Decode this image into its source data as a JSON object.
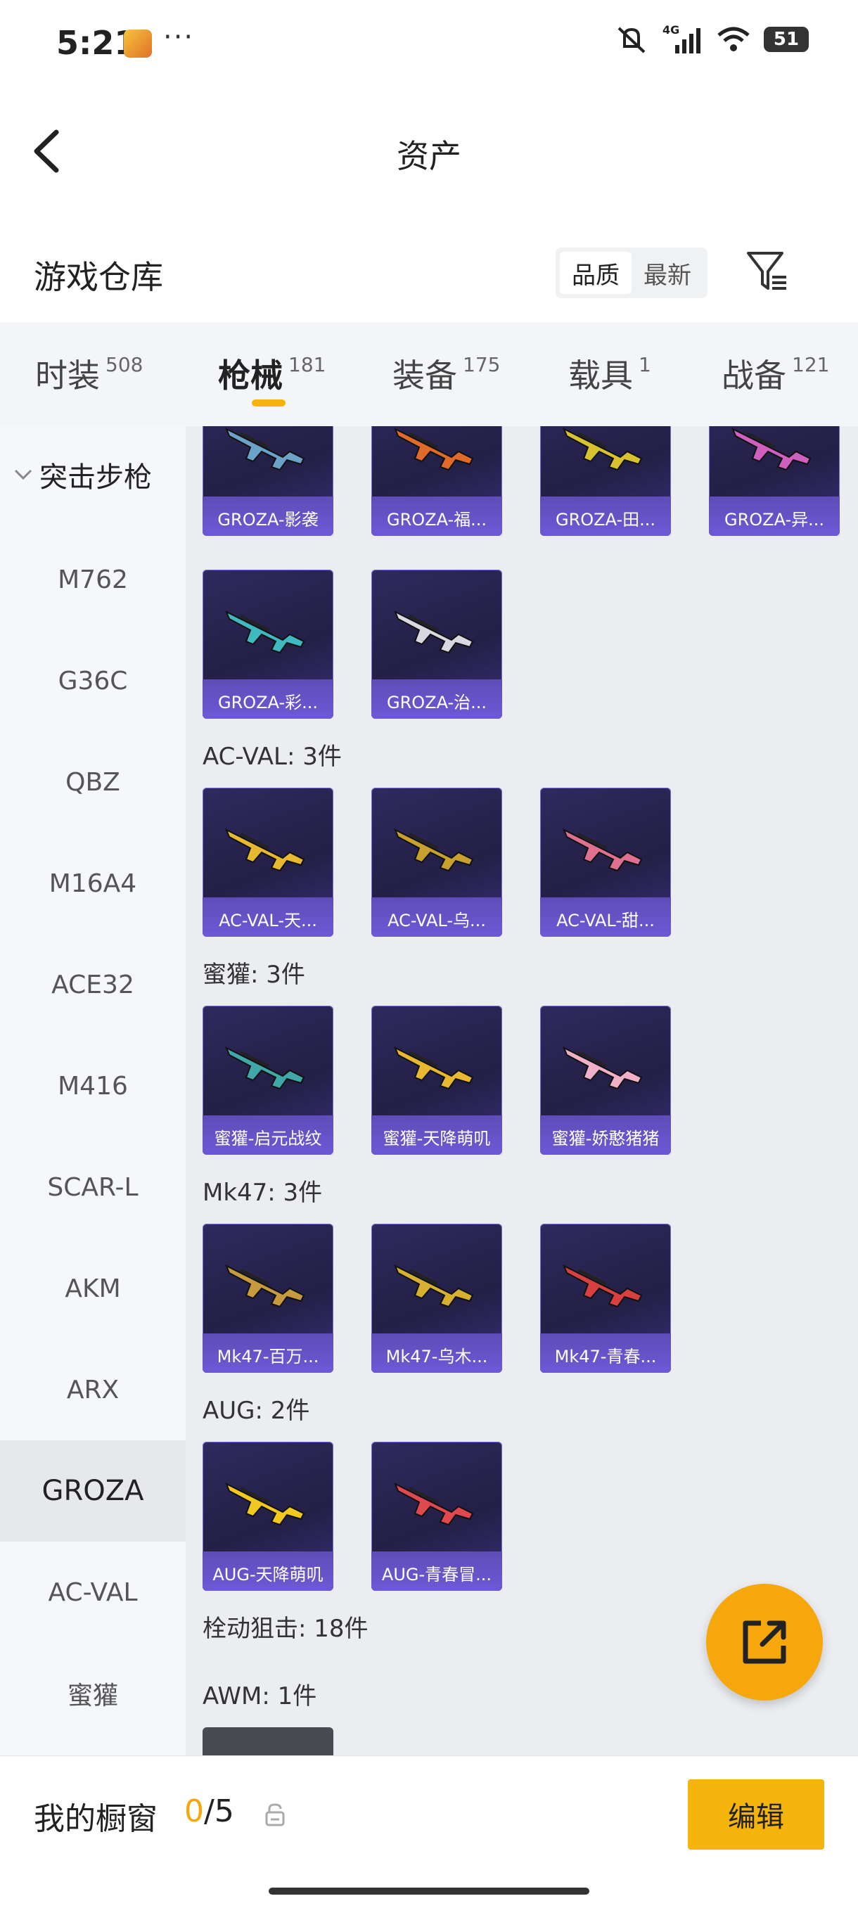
{
  "status_bar": {
    "time": "5:21",
    "dots": "···",
    "battery": "51",
    "network": "4G"
  },
  "header": {
    "title": "资产"
  },
  "warehouse": {
    "title": "游戏仓库",
    "sort_quality": "品质",
    "sort_newest": "最新"
  },
  "tabs": [
    {
      "label": "时装",
      "count": "508"
    },
    {
      "label": "枪械",
      "count": "181"
    },
    {
      "label": "装备",
      "count": "175"
    },
    {
      "label": "载具",
      "count": "1"
    },
    {
      "label": "战备",
      "count": "121"
    }
  ],
  "sidebar": {
    "category": "突击步枪",
    "items": [
      "M762",
      "G36C",
      "QBZ",
      "M16A4",
      "ACE32",
      "M416",
      "SCAR-L",
      "AKM",
      "ARX",
      "GROZA",
      "AC-VAL",
      "蜜獾"
    ],
    "active_index": 9
  },
  "groups": {
    "acval": "AC-VAL: 3件",
    "honey": "蜜獾: 3件",
    "mk47": "Mk47: 3件",
    "aug": "AUG: 2件",
    "bolt": "栓动狙击: 18件",
    "awm": "AWM: 1件"
  },
  "cards": {
    "groza_row1": [
      "GROZA-影袭",
      "GROZA-福...",
      "GROZA-田...",
      "GROZA-异..."
    ],
    "groza_row2": [
      "GROZA-彩...",
      "GROZA-治..."
    ],
    "acval": [
      "AC-VAL-天...",
      "AC-VAL-乌...",
      "AC-VAL-甜..."
    ],
    "honey": [
      "蜜獾-启元战纹",
      "蜜獾-天降萌叽",
      "蜜獾-娇憨猪猪"
    ],
    "mk47": [
      "Mk47-百万...",
      "Mk47-乌木...",
      "Mk47-青春..."
    ],
    "aug": [
      "AUG-天降萌叽",
      "AUG-青春冒..."
    ]
  },
  "gun_colors": {
    "groza_row1": [
      "#6aa2c8",
      "#e06a2a",
      "#d8c230",
      "#d060c0"
    ],
    "groza_row2": [
      "#3fb8c0",
      "#d8d8e0"
    ],
    "acval": [
      "#e8b830",
      "#c8a030",
      "#e07090"
    ],
    "honey": [
      "#40a8a8",
      "#e8b830",
      "#f0b0c8"
    ],
    "mk47": [
      "#c89a40",
      "#d8b030",
      "#d84040"
    ],
    "aug": [
      "#f0c820",
      "#e04850"
    ]
  },
  "bottom": {
    "showcase_label": "我的橱窗",
    "showcase_current": "0",
    "showcase_total": "/5",
    "edit_label": "编辑"
  }
}
